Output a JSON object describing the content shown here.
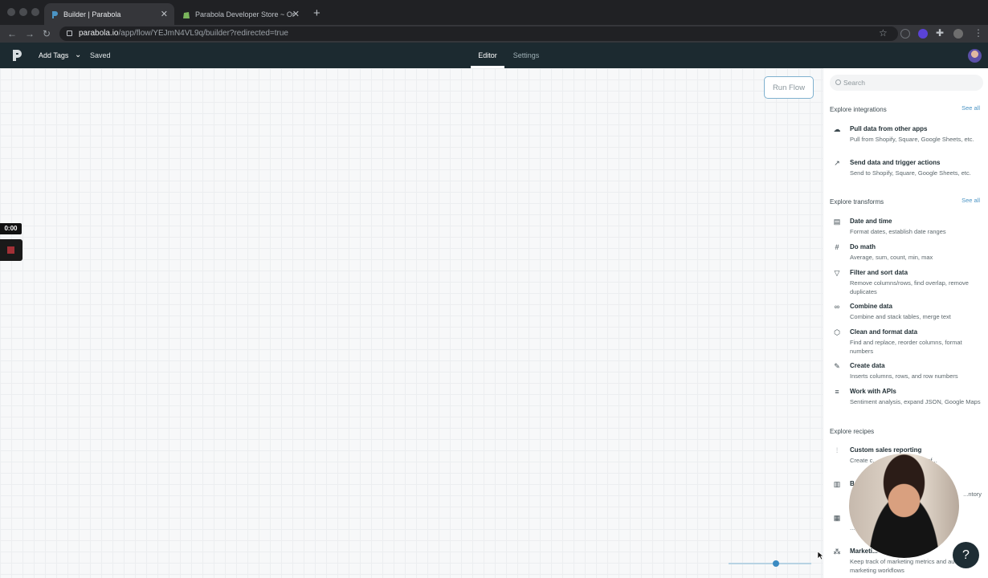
{
  "browser": {
    "tabs": [
      {
        "title": "Builder | Parabola",
        "active": true
      },
      {
        "title": "Parabola Developer Store ~ Or",
        "active": false
      }
    ],
    "url_domain": "parabola.io",
    "url_path": "/app/flow/YEJmN4VL9q/builder?redirected=true"
  },
  "appbar": {
    "add_tags": "Add Tags",
    "status": "Saved",
    "tabs": [
      "Editor",
      "Settings"
    ],
    "active_tab": "Editor"
  },
  "canvas": {
    "run_button": "Run Flow",
    "timer": "0:00",
    "zoom_level": 0.57
  },
  "panel": {
    "search_placeholder": "Search",
    "sections": [
      {
        "title": "Explore integrations",
        "see_all": "See all",
        "items": [
          {
            "icon": "cloud-download-icon",
            "title": "Pull data from other apps",
            "desc": "Pull from Shopify, Square, Google Sheets, etc."
          },
          {
            "icon": "external-link-icon",
            "title": "Send data and trigger actions",
            "desc": "Send to Shopify, Square, Google Sheets, etc."
          }
        ]
      },
      {
        "title": "Explore transforms",
        "see_all": "See all",
        "items": [
          {
            "icon": "calendar-icon",
            "title": "Date and time",
            "desc": "Format dates, establish date ranges"
          },
          {
            "icon": "hash-icon",
            "title": "Do math",
            "desc": "Average, sum, count, min, max"
          },
          {
            "icon": "filter-icon",
            "title": "Filter and sort data",
            "desc": "Remove columns/rows, find overlap, remove duplicates"
          },
          {
            "icon": "combine-icon",
            "title": "Combine data",
            "desc": "Combine and stack tables, merge text"
          },
          {
            "icon": "cube-icon",
            "title": "Clean and format data",
            "desc": "Find and replace, reorder columns, format numbers"
          },
          {
            "icon": "pencil-icon",
            "title": "Create data",
            "desc": "Inserts columns, rows, and row numbers"
          },
          {
            "icon": "database-icon",
            "title": "Work with APIs",
            "desc": "Sentiment analysis, expand JSON, Google Maps"
          }
        ]
      },
      {
        "title": "Explore recipes",
        "items": [
          {
            "icon": "sales-chart-icon",
            "title": "Custom sales reporting",
            "desc": "Create c... ...ith data from all of..."
          },
          {
            "icon": "bar-chart-icon",
            "title": "B",
            "desc": "...ntory"
          },
          {
            "icon": "calculator-icon",
            "title": "",
            "desc": "...d ret..."
          },
          {
            "icon": "share-icon",
            "title": "Marketi...",
            "desc": "Keep track of marketing metrics and automate marketing workflows"
          }
        ]
      }
    ]
  },
  "help_label": "?"
}
